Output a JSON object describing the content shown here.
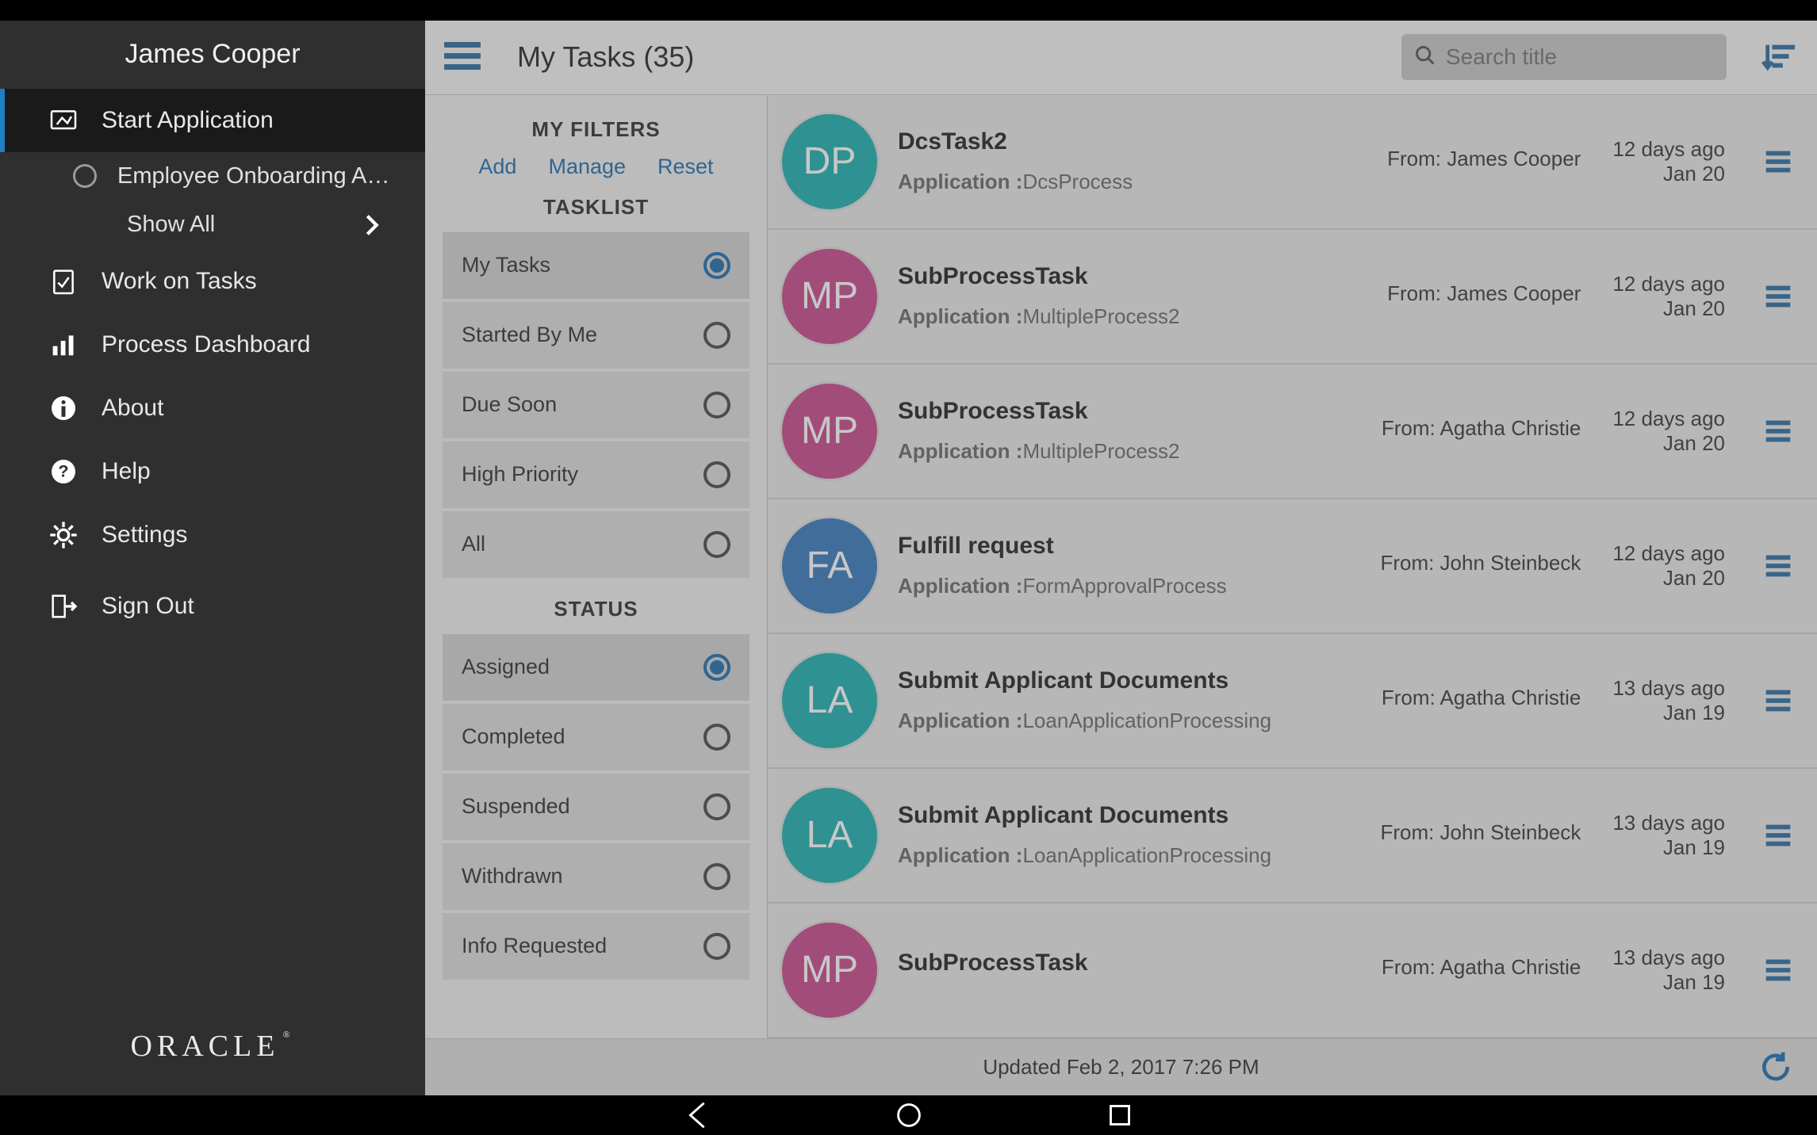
{
  "drawer": {
    "username": "James Cooper",
    "nav": {
      "start_application": "Start Application",
      "sub_employee_onboarding": "Employee Onboarding Applica",
      "show_all": "Show All",
      "work_on_tasks": "Work on Tasks",
      "process_dashboard": "Process Dashboard",
      "about": "About",
      "help": "Help",
      "settings": "Settings",
      "sign_out": "Sign Out"
    },
    "logo": "ORACLE"
  },
  "appbar": {
    "title": "My Tasks (35)",
    "search_placeholder": "Search title"
  },
  "filters": {
    "my_filters_label": "MY FILTERS",
    "actions": {
      "add": "Add",
      "manage": "Manage",
      "reset": "Reset"
    },
    "tasklist_label": "TASKLIST",
    "tasklist": [
      {
        "label": "My Tasks",
        "selected": true
      },
      {
        "label": "Started By Me",
        "selected": false
      },
      {
        "label": "Due Soon",
        "selected": false
      },
      {
        "label": "High Priority",
        "selected": false
      },
      {
        "label": "All",
        "selected": false
      }
    ],
    "status_label": "STATUS",
    "status": [
      {
        "label": "Assigned",
        "selected": true
      },
      {
        "label": "Completed",
        "selected": false
      },
      {
        "label": "Suspended",
        "selected": false
      },
      {
        "label": "Withdrawn",
        "selected": false
      },
      {
        "label": "Info Requested",
        "selected": false
      }
    ]
  },
  "tasks": {
    "application_prefix": "Application :",
    "from_prefix": "From: ",
    "items": [
      {
        "avatar_initials": "DP",
        "avatar_class": "av-teal",
        "title": "DcsTask2",
        "application": "DcsProcess",
        "from": "James Cooper",
        "age": "12 days ago",
        "date": "Jan 20"
      },
      {
        "avatar_initials": "MP",
        "avatar_class": "av-pink",
        "title": "SubProcessTask",
        "application": "MultipleProcess2",
        "from": "James Cooper",
        "age": "12 days ago",
        "date": "Jan 20"
      },
      {
        "avatar_initials": "MP",
        "avatar_class": "av-pink",
        "title": "SubProcessTask",
        "application": "MultipleProcess2",
        "from": "Agatha Christie",
        "age": "12 days ago",
        "date": "Jan 20"
      },
      {
        "avatar_initials": "FA",
        "avatar_class": "av-blue",
        "title": "Fulfill request",
        "application": "FormApprovalProcess",
        "from": "John Steinbeck",
        "age": "12 days ago",
        "date": "Jan 20"
      },
      {
        "avatar_initials": "LA",
        "avatar_class": "av-teal2",
        "title": "Submit Applicant Documents",
        "application": "LoanApplicationProcessing",
        "from": "Agatha Christie",
        "age": "13 days ago",
        "date": "Jan 19"
      },
      {
        "avatar_initials": "LA",
        "avatar_class": "av-teal2",
        "title": "Submit Applicant Documents",
        "application": "LoanApplicationProcessing",
        "from": "John Steinbeck",
        "age": "13 days ago",
        "date": "Jan 19"
      },
      {
        "avatar_initials": "MP",
        "avatar_class": "av-pink",
        "title": "SubProcessTask",
        "application": "",
        "from": "Agatha Christie",
        "age": "13 days ago",
        "date": "Jan 19"
      }
    ]
  },
  "footer": {
    "updated": "Updated Feb 2, 2017 7:26 PM"
  }
}
